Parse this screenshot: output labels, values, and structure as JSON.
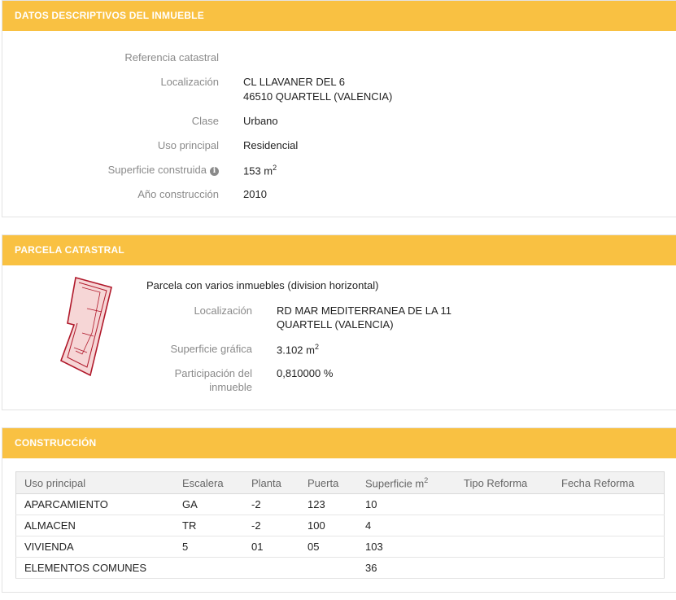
{
  "datos": {
    "header": "DATOS DESCRIPTIVOS DEL INMUEBLE",
    "ref_label": "Referencia catastral",
    "ref_value": "",
    "loc_label": "Localización",
    "loc_line1": "CL LLAVANER DEL 6",
    "loc_line2": "46510 QUARTELL (VALENCIA)",
    "clase_label": "Clase",
    "clase_value": "Urbano",
    "uso_label": "Uso principal",
    "uso_value": "Residencial",
    "sup_label": "Superficie construida",
    "sup_value": "153 m",
    "sup_unit_exp": "2",
    "anio_label": "Año construcción",
    "anio_value": "2010"
  },
  "parcela": {
    "header": "PARCELA CATASTRAL",
    "title": "Parcela con varios inmuebles (division horizontal)",
    "loc_label": "Localización",
    "loc_line1": "RD MAR MEDITERRANEA DE LA 11",
    "loc_line2": "QUARTELL (VALENCIA)",
    "sup_label": "Superficie gráfica",
    "sup_value": "3.102 m",
    "sup_unit_exp": "2",
    "part_label_1": "Participación del",
    "part_label_2": "inmueble",
    "part_value": "0,810000 %"
  },
  "construccion": {
    "header": "CONSTRUCCIÓN",
    "columns": [
      "Uso principal",
      "Escalera",
      "Planta",
      "Puerta",
      "Superficie m",
      "Tipo Reforma",
      "Fecha Reforma"
    ],
    "sup_col_exp": "2",
    "rows": [
      [
        "APARCAMIENTO",
        "GA",
        "-2",
        "123",
        "10",
        "",
        ""
      ],
      [
        "ALMACEN",
        "TR",
        "-2",
        "100",
        "4",
        "",
        ""
      ],
      [
        "VIVIENDA",
        "5",
        "01",
        "05",
        "103",
        "",
        ""
      ],
      [
        "ELEMENTOS COMUNES",
        "",
        "",
        "",
        "36",
        "",
        ""
      ]
    ]
  },
  "icons": {
    "info": "info-icon",
    "info_glyph": "i"
  },
  "colors": {
    "header_bg": "#f9c142",
    "label": "#8a8a8a",
    "parcel_outline": "#b0182a",
    "parcel_fill": "#f6d6d6"
  }
}
